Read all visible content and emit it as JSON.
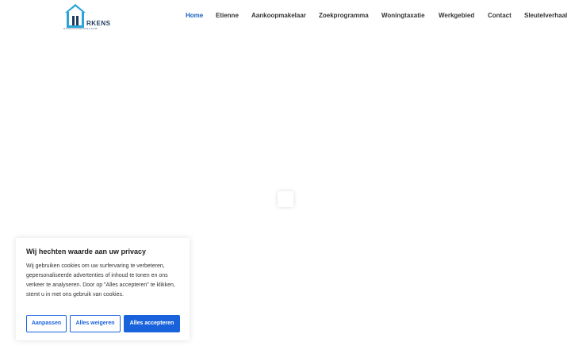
{
  "header": {
    "logo": {
      "word": "RKENS",
      "subtitle": "AANKOOPMAKELAAR"
    },
    "nav": [
      {
        "label": "Home",
        "active": true
      },
      {
        "label": "Etienne",
        "active": false
      },
      {
        "label": "Aankoopmakelaar",
        "active": false
      },
      {
        "label": "Zoekprogramma",
        "active": false
      },
      {
        "label": "Woningtaxatie",
        "active": false
      },
      {
        "label": "Werkgebied",
        "active": false
      },
      {
        "label": "Contact",
        "active": false
      },
      {
        "label": "Sleutelverhaal",
        "active": false
      }
    ]
  },
  "cookie_banner": {
    "title": "Wij hechten waarde aan uw privacy",
    "text": "Wij gebruiken cookies om uw surfervaring te verbeteren, gepersonaliseerde advertenties of inhoud te tonen en ons verkeer te analyseren. Door op \"Alles accepteren\" te klikken, stemt u in met ons gebruik van cookies.",
    "buttons": {
      "customize": "Aanpassen",
      "reject": "Alles weigeren",
      "accept": "Alles accepteren"
    }
  },
  "colors": {
    "nav_active": "#1a5fbf",
    "logo_house": "#2aa3d6",
    "logo_text": "#1e3a5f",
    "button_primary": "#1863dc"
  }
}
